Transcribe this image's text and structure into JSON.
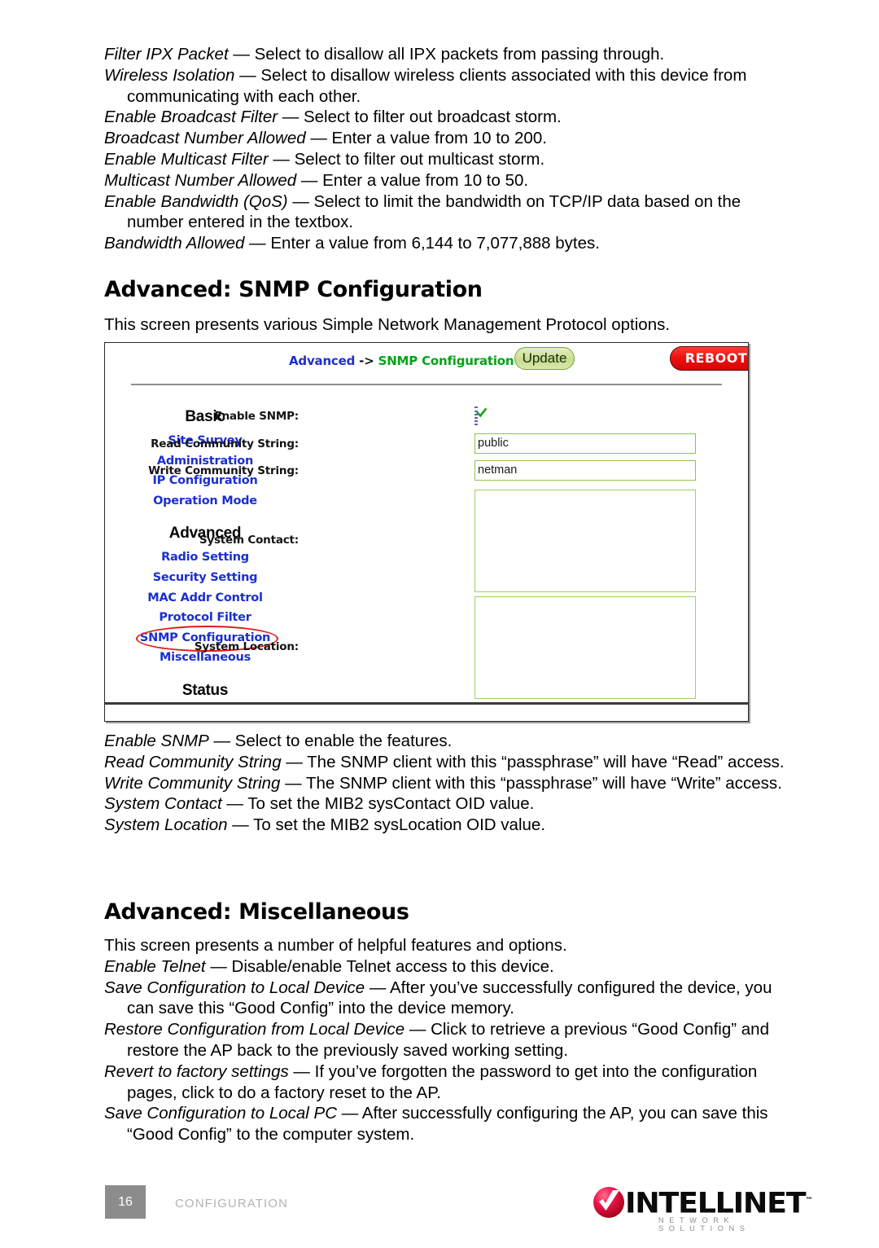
{
  "top_paragraphs": [
    {
      "term": "Filter IPX Packet",
      "dash": " — ",
      "rest": "Select to disallow all IPX packets from passing through.",
      "cont": ""
    },
    {
      "term": "Wireless Isolation",
      "dash": " — ",
      "rest": "Select to disallow wireless clients associated with this device",
      "cont": "from communicating with each other."
    },
    {
      "term": "Enable Broadcast Filter",
      "dash": " — ",
      "rest": "Select to filter out broadcast storm.",
      "cont": ""
    },
    {
      "term": "Broadcast Number Allowed",
      "dash": " — ",
      "rest": "Enter a value from 10 to 200.",
      "cont": ""
    },
    {
      "term": "Enable Multicast Filter",
      "dash": " — ",
      "rest": "Select to filter out multicast storm.",
      "cont": ""
    },
    {
      "term": "Multicast Number Allowed",
      "dash": " — ",
      "rest": "Enter a value from 10 to 50.",
      "cont": ""
    },
    {
      "term": "Enable Bandwidth (QoS)",
      "dash": " — ",
      "rest": "Select to limit the bandwidth on TCP/IP data based",
      "cont": "on the number entered in the textbox."
    },
    {
      "term": "Bandwidth Allowed",
      "dash": " — ",
      "rest": "Enter a value from 6,144 to 7,077,888 bytes.",
      "cont": ""
    }
  ],
  "snmp_section": {
    "heading": "Advanced: SNMP Configuration",
    "intro": "This screen presents various Simple Network Management Protocol options.",
    "paragraphs": [
      {
        "term": "Enable SNMP",
        "dash": " — ",
        "rest": "Select to enable the features.",
        "cont": ""
      },
      {
        "term": "Read Community String",
        "dash": " — ",
        "rest": "The SNMP client with this “passphrase” will have",
        "cont": "“Read” access."
      },
      {
        "term": "Write Community String",
        "dash": " —  ",
        "rest": "The SNMP client with this “passphrase” will have",
        "cont": "“Write” access."
      },
      {
        "term": "System Contact",
        "dash": " — ",
        "rest": "To set the MIB2 sysContact OID value.",
        "cont": ""
      },
      {
        "term": "System Location",
        "dash": " — ",
        "rest": "To set the MIB2 sysLocation OID value.",
        "cont": ""
      }
    ]
  },
  "screenshot": {
    "breadcrumb": {
      "parent": "Advanced",
      "separator": " -> ",
      "current": "SNMP Configuration"
    },
    "update_button": "Update",
    "reboot_button": "REBOOT",
    "colors": {
      "link_blue": "#1b2fd0",
      "current_green": "#00a415",
      "reboot_red": "#ee1111",
      "update_green": "#c7dd8f",
      "field_border_green": "#8ec44c",
      "annotation_red": "#e31a1a"
    },
    "nav": [
      {
        "type": "group",
        "label": "Basic"
      },
      {
        "type": "link",
        "label": "Site Survey",
        "circled": false
      },
      {
        "type": "link",
        "label": "Administration",
        "circled": false
      },
      {
        "type": "link",
        "label": "IP Configuration",
        "circled": false
      },
      {
        "type": "link",
        "label": "Operation Mode",
        "circled": false
      },
      {
        "type": "gap",
        "label": ""
      },
      {
        "type": "group",
        "label": "Advanced"
      },
      {
        "type": "link",
        "label": "Radio Setting",
        "circled": false
      },
      {
        "type": "link",
        "label": "Security Setting",
        "circled": false
      },
      {
        "type": "link",
        "label": "MAC Addr Control",
        "circled": false
      },
      {
        "type": "link",
        "label": "Protocol Filter",
        "circled": false
      },
      {
        "type": "link",
        "label": "SNMP Configuration",
        "circled": true
      },
      {
        "type": "link",
        "label": "Miscellaneous",
        "circled": false
      },
      {
        "type": "gap",
        "label": ""
      },
      {
        "type": "group",
        "label": "Status"
      }
    ],
    "fields": {
      "enable_snmp_label": "Enable SNMP:",
      "enable_snmp_checked": true,
      "read_community_label": "Read Community String:",
      "read_community_value": "public",
      "write_community_label": "Write Community String:",
      "write_community_value": "netman",
      "system_contact_label": "System Contact:",
      "system_contact_value": "",
      "system_location_label": "System Location:",
      "system_location_value": ""
    }
  },
  "misc_section": {
    "heading": "Advanced: Miscellaneous",
    "intro": "This screen presents a number of helpful features and options.",
    "paragraphs": [
      {
        "term": "Enable Telnet",
        "dash": " — ",
        "rest": "Disable/enable Telnet access to this device.",
        "cont": ""
      },
      {
        "term": "Save Configuration to Local Device",
        "dash": " — ",
        "rest": "After you’ve successfully configured the",
        "cont": "device, you can save this “Good Config” into the device memory."
      },
      {
        "term": "Restore Configuration from Local Device",
        "dash": " — ",
        "rest": "Click to retrieve a previous “Good",
        "cont": "Config” and restore the AP back to the previously saved working setting."
      },
      {
        "term": "Revert to factory settings",
        "dash": " — ",
        "rest": "If you’ve forgotten the password to get into the",
        "cont": "configuration pages, click to do a factory reset to the AP."
      },
      {
        "term": "Save Configuration to Local PC",
        "dash": " — ",
        "rest": "After successfully configuring the AP, you can",
        "cont": "save this “Good Config” to the computer system."
      }
    ]
  },
  "footer": {
    "page_number": "16",
    "section_label": "CONFIGURATION",
    "logo_word": "INTELLINET",
    "logo_tm": "™",
    "logo_tagline": "NETWORK SOLUTIONS"
  }
}
